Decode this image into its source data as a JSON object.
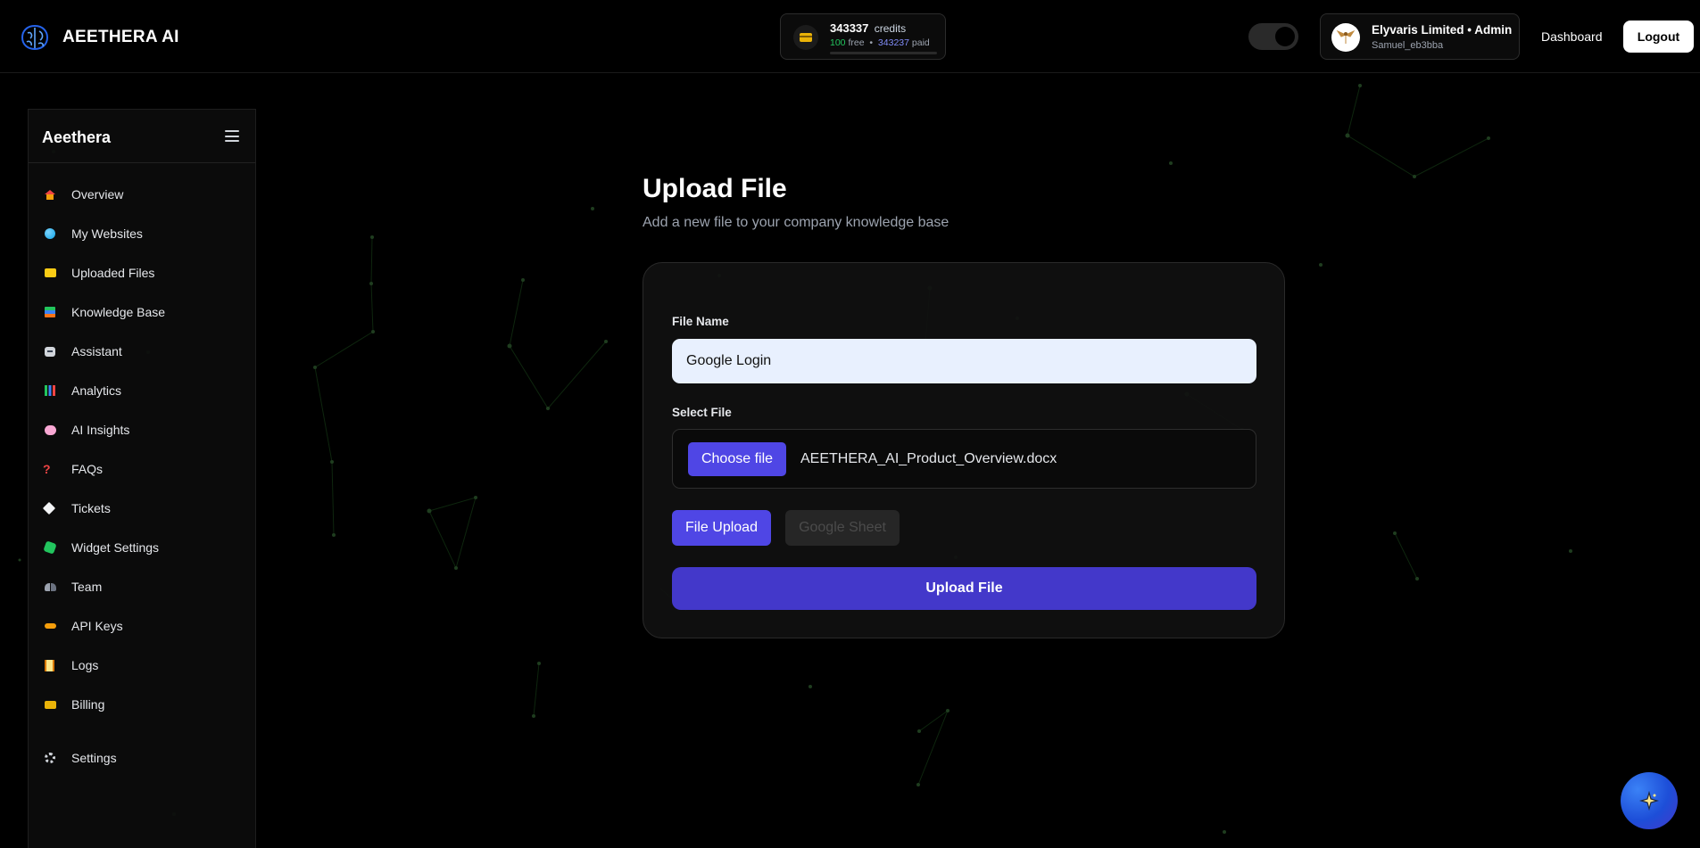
{
  "header": {
    "brand": "AEETHERA AI",
    "credits": {
      "total": "343337",
      "label": "credits",
      "free_value": "100",
      "free_label": "free",
      "separator": "•",
      "paid_value": "343237",
      "paid_label": "paid"
    },
    "theme_toggle": {
      "state": "dark"
    },
    "user": {
      "name": "Elyvaris Limited • Admin",
      "handle": "Samuel_eb3bba"
    },
    "dashboard_link": "Dashboard",
    "logout_label": "Logout"
  },
  "sidebar": {
    "title": "Aeethera",
    "items": [
      {
        "label": "Overview",
        "icon": "house-icon"
      },
      {
        "label": "My Websites",
        "icon": "globe-icon"
      },
      {
        "label": "Uploaded Files",
        "icon": "folder-icon"
      },
      {
        "label": "Knowledge Base",
        "icon": "books-icon"
      },
      {
        "label": "Assistant",
        "icon": "robot-icon"
      },
      {
        "label": "Analytics",
        "icon": "bar-chart-icon"
      },
      {
        "label": "AI Insights",
        "icon": "brain-icon"
      },
      {
        "label": "FAQs",
        "icon": "question-mark-icon"
      },
      {
        "label": "Tickets",
        "icon": "ticket-icon"
      },
      {
        "label": "Widget Settings",
        "icon": "puzzle-icon"
      },
      {
        "label": "Team",
        "icon": "team-icon"
      },
      {
        "label": "API Keys",
        "icon": "key-icon"
      },
      {
        "label": "Logs",
        "icon": "scroll-icon"
      },
      {
        "label": "Billing",
        "icon": "credit-card-icon"
      },
      {
        "label": "Settings",
        "icon": "gear-icon"
      }
    ]
  },
  "main": {
    "title": "Upload File",
    "subtitle": "Add a new file to your company knowledge base",
    "form": {
      "file_name_label": "File Name",
      "file_name_value": "Google Login",
      "select_file_label": "Select File",
      "choose_file_label": "Choose file",
      "selected_file": "AEETHERA_AI_Product_Overview.docx",
      "tabs": [
        "File Upload",
        "Google Sheet"
      ],
      "active_tab": "File Upload",
      "submit_label": "Upload File"
    }
  },
  "colors": {
    "accent": "#4f46e5",
    "submit": "#4338ca",
    "background": "#000000",
    "free_credits": "#22c55e",
    "paid_credits": "#818cf8"
  },
  "fab": {
    "icon": "sparkle-icon"
  }
}
